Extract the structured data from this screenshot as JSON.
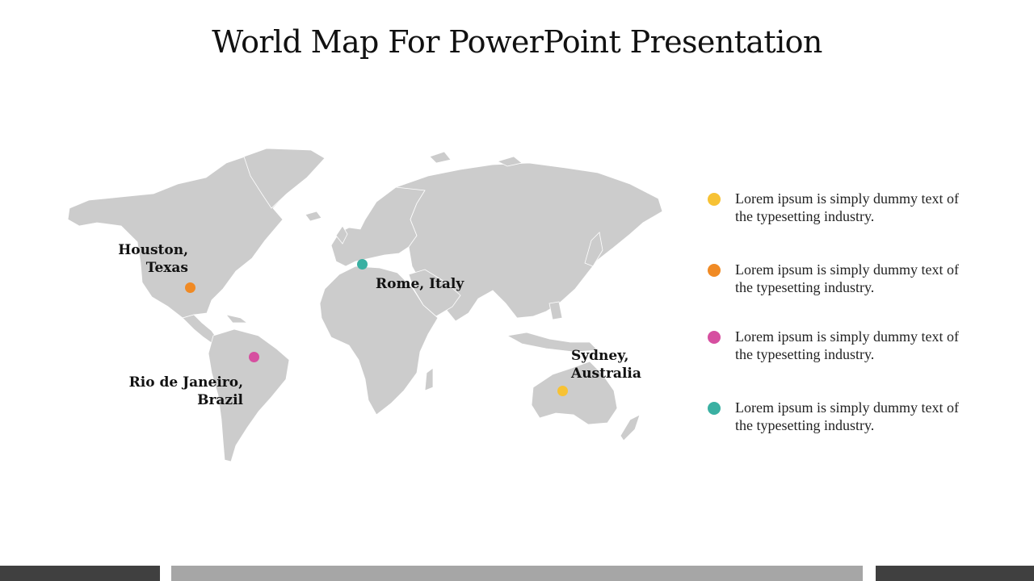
{
  "slide": {
    "title": "World Map For PowerPoint Presentation"
  },
  "map": {
    "land_color": "#cccccc",
    "cities": [
      {
        "label": "Houston,\nTexas",
        "pin_color": "#f08a24"
      },
      {
        "label": "Rome, Italy",
        "pin_color": "#3ab0a2"
      },
      {
        "label": "Rio de Janeiro,\nBrazil",
        "pin_color": "#d64fa0"
      },
      {
        "label": "Sydney,\nAustralia",
        "pin_color": "#f7c234"
      }
    ]
  },
  "legend": {
    "items": [
      {
        "text": "Lorem ipsum is simply dummy text of the typesetting industry.",
        "color": "#f7c234"
      },
      {
        "text": "Lorem ipsum is simply dummy text of the typesetting industry.",
        "color": "#f08a24"
      },
      {
        "text": "Lorem ipsum is simply dummy text of the typesetting industry.",
        "color": "#d64fa0"
      },
      {
        "text": "Lorem ipsum is simply dummy text of the typesetting industry.",
        "color": "#3ab0a2"
      }
    ]
  },
  "footer": {
    "dark_color": "#404040",
    "mid_color": "#a6a6a6"
  }
}
